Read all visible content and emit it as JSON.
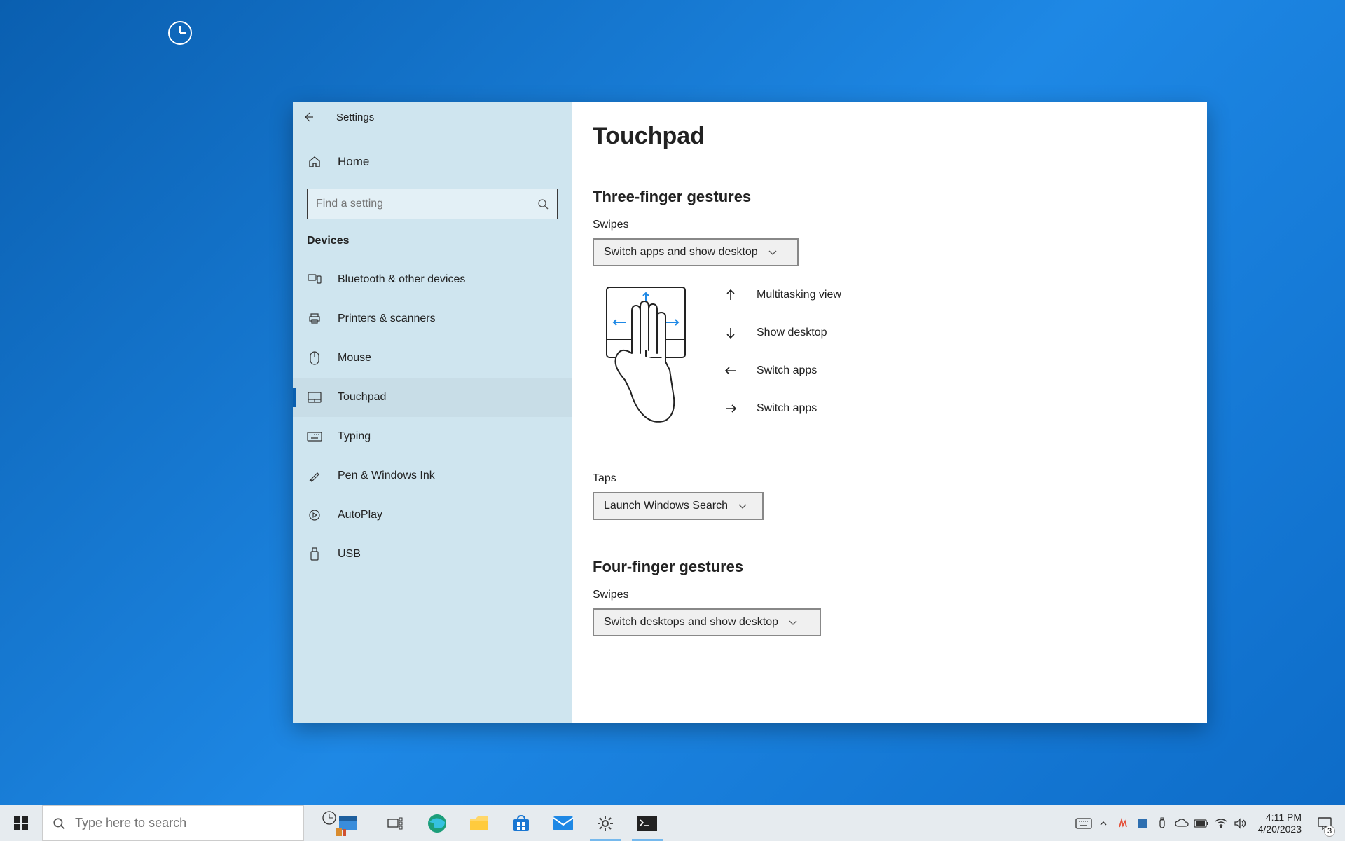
{
  "window": {
    "title": "Settings"
  },
  "sidebar": {
    "home": "Home",
    "search_placeholder": "Find a setting",
    "category": "Devices",
    "items": [
      {
        "label": "Bluetooth & other devices"
      },
      {
        "label": "Printers & scanners"
      },
      {
        "label": "Mouse"
      },
      {
        "label": "Touchpad"
      },
      {
        "label": "Typing"
      },
      {
        "label": "Pen & Windows Ink"
      },
      {
        "label": "AutoPlay"
      },
      {
        "label": "USB"
      }
    ]
  },
  "page": {
    "title": "Touchpad",
    "three": {
      "heading": "Three-finger gestures",
      "swipes_label": "Swipes",
      "swipes_value": "Switch apps and show desktop",
      "gestures": [
        {
          "label": "Multitasking view"
        },
        {
          "label": "Show desktop"
        },
        {
          "label": "Switch apps"
        },
        {
          "label": "Switch apps"
        }
      ],
      "taps_label": "Taps",
      "taps_value": "Launch Windows Search"
    },
    "four": {
      "heading": "Four-finger gestures",
      "swipes_label": "Swipes",
      "swipes_value": "Switch desktops and show desktop"
    }
  },
  "taskbar": {
    "search_placeholder": "Type here to search",
    "time": "4:11 PM",
    "date": "4/20/2023",
    "notif_count": "3"
  }
}
